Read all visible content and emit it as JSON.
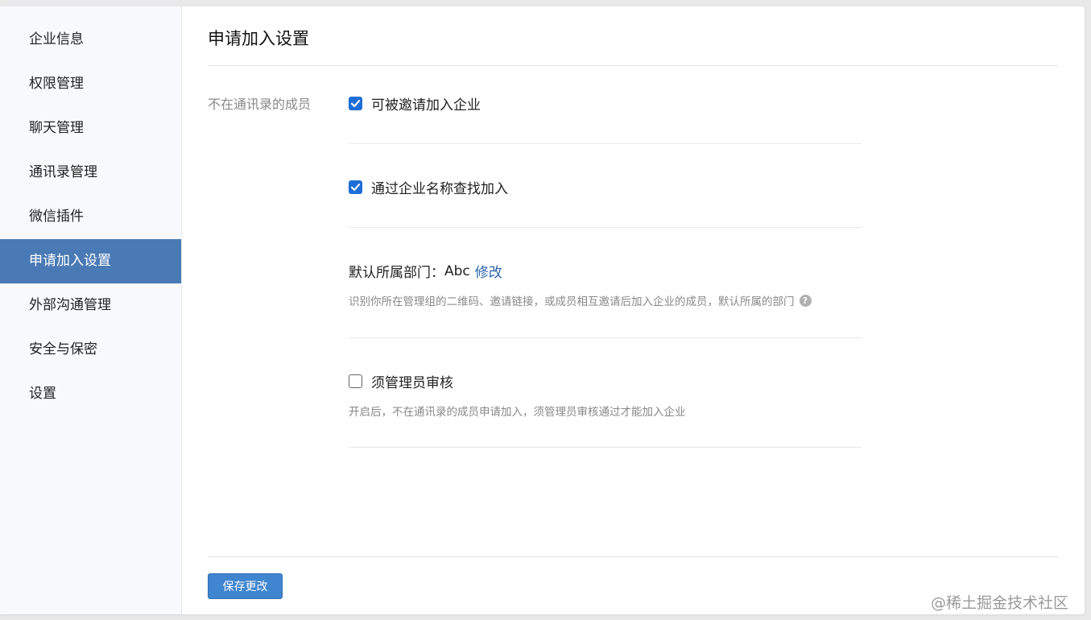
{
  "sidebar": {
    "items": [
      {
        "label": "企业信息"
      },
      {
        "label": "权限管理"
      },
      {
        "label": "聊天管理"
      },
      {
        "label": "通讯录管理"
      },
      {
        "label": "微信插件"
      },
      {
        "label": "申请加入设置",
        "active": true
      },
      {
        "label": "外部沟通管理"
      },
      {
        "label": "安全与保密"
      },
      {
        "label": "设置"
      }
    ]
  },
  "main": {
    "title": "申请加入设置",
    "section_label": "不在通讯录的成员",
    "options": [
      {
        "label": "可被邀请加入企业",
        "checked": true
      },
      {
        "label": "通过企业名称查找加入",
        "checked": true
      }
    ],
    "default_dept": {
      "label": "默认所属部门：",
      "value": "Abc",
      "edit_link": "修改",
      "description": "识别你所在管理组的二维码、邀请链接，或成员相互邀请后加入企业的成员，默认所属的部门",
      "help_icon": "?"
    },
    "admin_review": {
      "label": "须管理员审核",
      "checked": false,
      "description": "开启后，不在通讯录的成员申请加入，须管理员审核通过才能加入企业"
    },
    "save_button": "保存更改"
  },
  "watermark": "@稀土掘金技术社区",
  "colors": {
    "accent": "#4a7ab5",
    "checkbox": "#1d6ed6",
    "link": "#2b63a8"
  }
}
